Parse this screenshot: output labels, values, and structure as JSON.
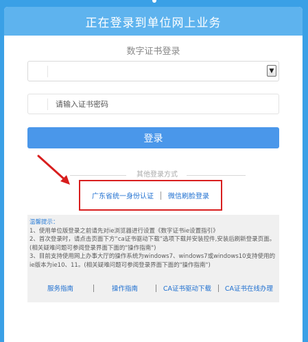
{
  "header": {
    "title": "正在登录到单位网上业务"
  },
  "login": {
    "subtitle": "数字证书登录",
    "cert_select_value": "",
    "password_placeholder": "请输入证书密码",
    "login_button": "登录"
  },
  "other_methods": {
    "label": "其他登录方式",
    "links": [
      "广东省统一身份认证",
      "微信刷脸登录"
    ]
  },
  "tips": {
    "title": "温馨提示：",
    "items": [
      "1、使用单位版登录之前请先对ie浏览器进行设置《数字证书ie设置指引》",
      "2、首次登录时，请点击页面下方“ca证书驱动下载”选项下载并安装控件,安装后刷新登录页面。(相关疑难问题可参阅登录界面下面的\"操作指南\")",
      "3、目前支持使用网上办事大厅的操作系统为windows7、windows7或windows10支持使用的ie版本为ie10、11。(相关疑难问题可参阅登录界面下面的\"操作指南\")"
    ]
  },
  "footer": {
    "links": [
      "服务指南",
      "操作指南",
      "CA证书驱动下载",
      "CA证书在线办理"
    ]
  },
  "colors": {
    "background": "#3aa0e6",
    "header": "#5eb3ee",
    "primary_button": "#4a97ea",
    "highlight_box": "#d81e1e",
    "link": "#1e6fd0"
  },
  "icons": {
    "annotation_arrow": "red-arrow-icon",
    "select_arrow": "chevron-down-icon"
  }
}
